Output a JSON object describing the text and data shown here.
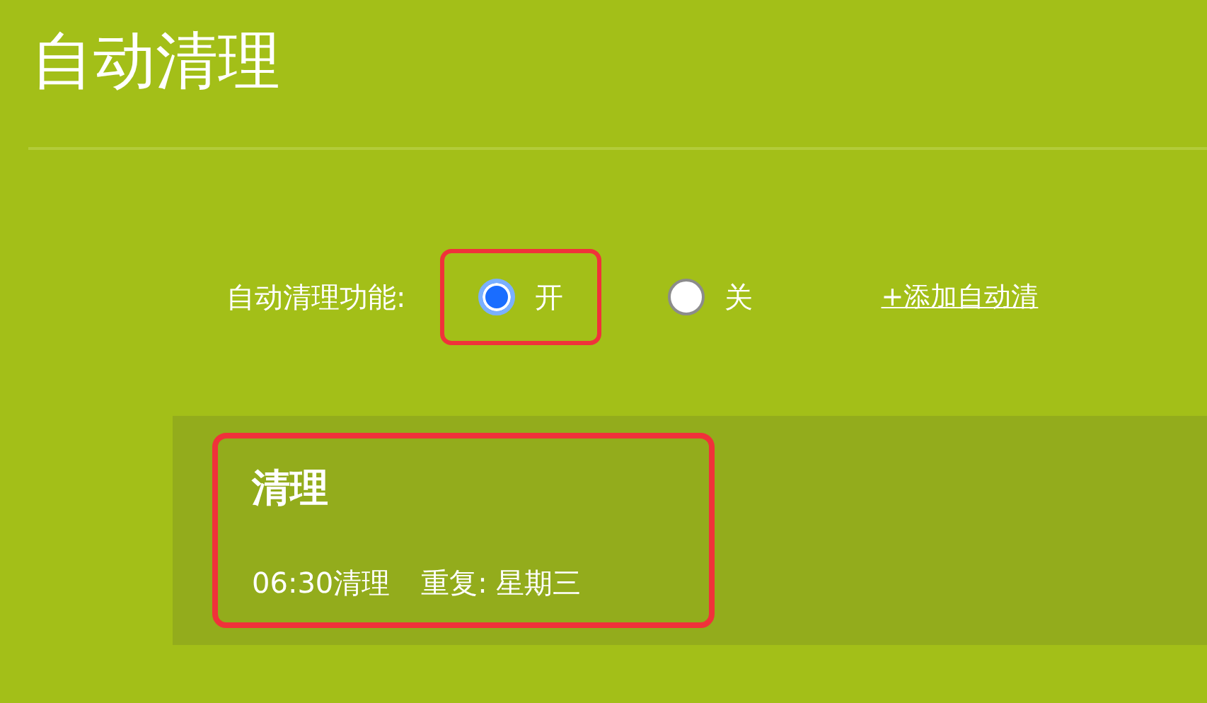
{
  "page": {
    "title": "自动清理"
  },
  "setting": {
    "label": "自动清理功能:",
    "options": [
      {
        "label": "开",
        "selected": true,
        "highlighted": true
      },
      {
        "label": "关",
        "selected": false,
        "highlighted": false
      }
    ],
    "add_link": "+添加自动清"
  },
  "schedules": [
    {
      "name": "清理",
      "time": "06:30清理",
      "repeat": "重复: 星期三",
      "highlighted": true
    }
  ]
}
